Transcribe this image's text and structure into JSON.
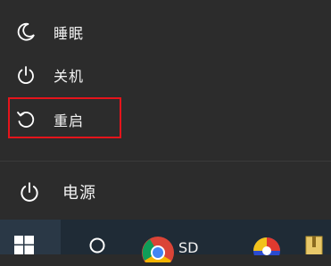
{
  "power_menu": {
    "items": [
      {
        "label": "睡眠",
        "icon": "moon-icon"
      },
      {
        "label": "关机",
        "icon": "power-icon"
      },
      {
        "label": "重启",
        "icon": "restart-icon",
        "highlighted": true
      }
    ],
    "power_button_label": "电源",
    "highlight_color": "#e5141b"
  },
  "taskbar": {
    "chrome_label": "SD",
    "icons": [
      "windows-logo-icon",
      "search-icon",
      "chrome-icon",
      "app-icon",
      "archive-icon"
    ]
  }
}
